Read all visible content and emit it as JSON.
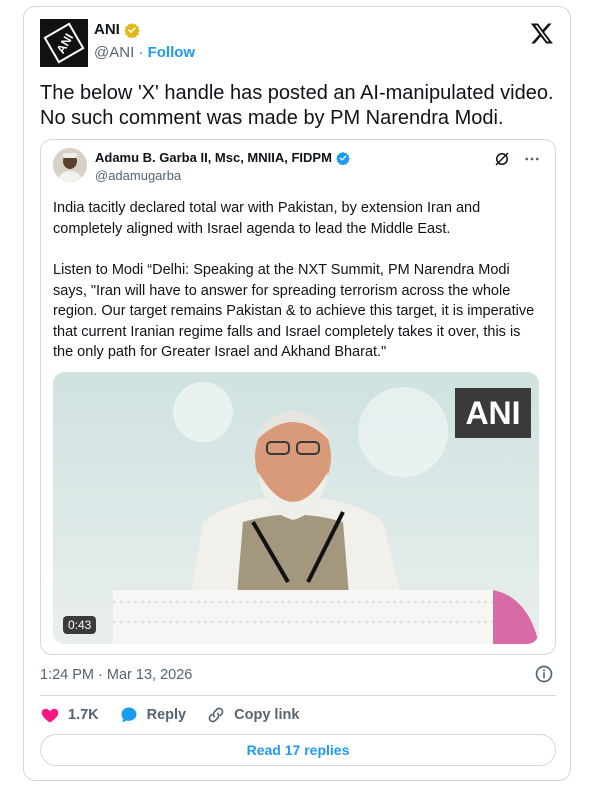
{
  "tweet": {
    "author_name": "ANI",
    "author_handle": "@ANI",
    "separator": "·",
    "follow_label": "Follow",
    "logo_text": "ANI",
    "text": "The below 'X' handle has posted an AI-manipulated video. No such comment was made by PM Narendra Modi.",
    "timestamp": "1:24 PM · Mar 13, 2026",
    "likes": "1.7K",
    "reply_label": "Reply",
    "copy_link_label": "Copy link",
    "read_replies_label": "Read 17 replies"
  },
  "quoted": {
    "author_name": "Adamu B. Garba II, Msc, MNIIA, FIDPM",
    "author_handle": "@adamugarba",
    "paragraph_1": "India tacitly declared total war with Pakistan, by extension Iran and completely aligned with Israel agenda to lead the Middle East.",
    "paragraph_2": "Listen to Modi “Delhi: Speaking at the NXT Summit, PM Narendra Modi says, \"Iran will have to answer for spreading terrorism across the whole region. Our target remains Pakistan & to achieve this target, it is imperative that current Iranian regime falls and Israel completely takes it over, this is the only path for Greater Israel and Akhand Bharat.\"",
    "video_watermark": "ANI",
    "video_duration": "0:43"
  },
  "colors": {
    "accent": "#1d9bf0",
    "heart": "#f91880",
    "text_secondary": "#536471",
    "border": "#cfd9de",
    "verified_gold": "#e2b719"
  },
  "icons": [
    "x-logo-icon",
    "verified-badge-icon",
    "grok-icon",
    "more-icon",
    "info-icon",
    "heart-icon",
    "reply-icon",
    "link-icon"
  ]
}
